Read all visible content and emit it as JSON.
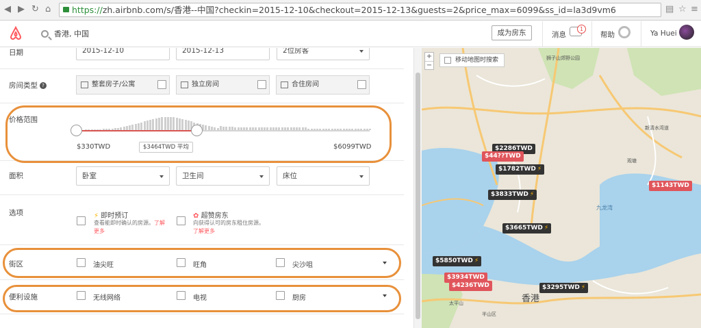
{
  "browser": {
    "url_https": "https://",
    "url_rest": "zh.airbnb.com/s/香港--中国?checkin=2015-12-10&checkout=2015-12-13&guests=2&price_max=6099&ss_id=la3d9vm6"
  },
  "header": {
    "search_value": "香港, 中国",
    "host_button": "成为房东",
    "messages_label": "消息",
    "messages_count": "1",
    "help_label": "帮助",
    "user_name": "Ya Huei"
  },
  "filters": {
    "dates": {
      "label": "日期",
      "checkin": "2015-12-10",
      "checkout": "2015-12-13",
      "guests": "2位房客"
    },
    "room_type": {
      "label": "房间类型",
      "options": [
        "整套房子/公寓",
        "独立房间",
        "合住房间"
      ]
    },
    "price": {
      "label": "价格范围",
      "min": "$330TWD",
      "max": "$6099TWD",
      "avg": "$3464TWD 平均",
      "selected_max_fraction": 0.41
    },
    "size": {
      "label": "面积",
      "bedrooms": "卧室",
      "bathrooms": "卫生间",
      "beds": "床位"
    },
    "options": {
      "label": "选项",
      "instant_title": "即时预订",
      "instant_desc": "查看能即时确认的房源。",
      "instant_link": "了解更多",
      "superhost_title": "超赞房东",
      "superhost_desc": "向获得认可的房东租住房源。",
      "superhost_link": "了解更多"
    },
    "neighborhoods": {
      "label": "街区",
      "items": [
        "油尖旺",
        "旺角",
        "尖沙咀"
      ]
    },
    "amenities": {
      "label": "便利设施",
      "items": [
        "无线网络",
        "电视",
        "厨房"
      ]
    }
  },
  "map": {
    "move_search_label": "移动地图时搜索",
    "zoom_in": "+",
    "zoom_out": "−",
    "place_labels": [
      "狮子山郊野公园",
      "九龙湾",
      "香港",
      "观塘",
      "太平山",
      "半山区",
      "新清水湾道"
    ],
    "price_pins": [
      {
        "label": "$2286TWD",
        "type": "dark"
      },
      {
        "label": "$44??TWD",
        "type": "red"
      },
      {
        "label": "$1782TWD",
        "type": "dark"
      },
      {
        "label": "$1143TWD",
        "type": "red"
      },
      {
        "label": "$3833TWD",
        "type": "dark"
      },
      {
        "label": "$3665TWD",
        "type": "dark"
      },
      {
        "label": "$5850TWD",
        "type": "dark"
      },
      {
        "label": "$3934TWD",
        "type": "red"
      },
      {
        "label": "$4236TWD",
        "type": "red"
      },
      {
        "label": "$3295TWD",
        "type": "dark"
      }
    ]
  },
  "colors": {
    "brand": "#ff5a5f",
    "highlight_annotation": "#e8903a"
  }
}
